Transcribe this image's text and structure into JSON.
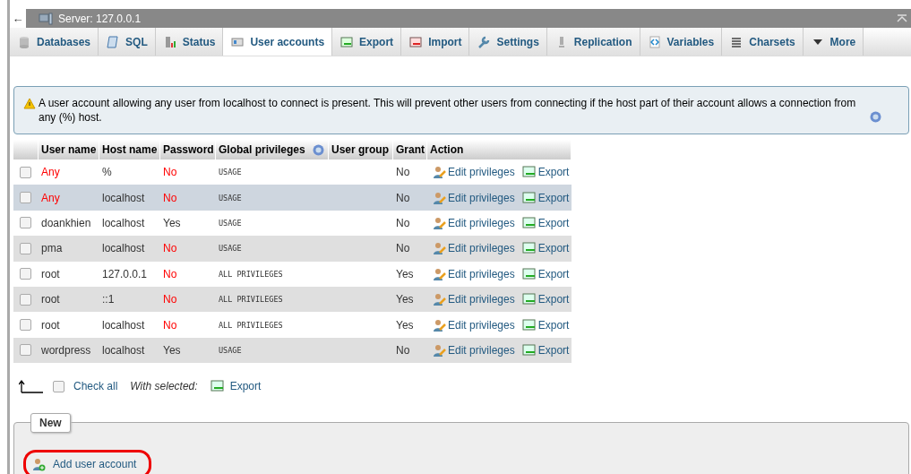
{
  "breadcrumb": {
    "back": "←",
    "server": "Server: 127.0.0.1"
  },
  "tabs": [
    {
      "label": "Databases",
      "kind": "db",
      "selected": false
    },
    {
      "label": "SQL",
      "kind": "sql",
      "selected": false
    },
    {
      "label": "Status",
      "kind": "status",
      "selected": false
    },
    {
      "label": "User accounts",
      "kind": "users",
      "selected": true
    },
    {
      "label": "Export",
      "kind": "export",
      "selected": false
    },
    {
      "label": "Import",
      "kind": "import",
      "selected": false
    },
    {
      "label": "Settings",
      "kind": "settings",
      "selected": false
    },
    {
      "label": "Replication",
      "kind": "replication",
      "selected": false
    },
    {
      "label": "Variables",
      "kind": "variables",
      "selected": false
    },
    {
      "label": "Charsets",
      "kind": "charsets",
      "selected": false
    },
    {
      "label": "More",
      "kind": "more",
      "selected": false
    }
  ],
  "warning": "A user account allowing any user from localhost to connect is present. This will prevent other users from connecting if the host part of their account allows a connection from any (%) host.",
  "table": {
    "columns": [
      "User name",
      "Host name",
      "Password",
      "Global privileges",
      "User group",
      "Grant",
      "Action"
    ],
    "rows": [
      {
        "user": "Any",
        "any_user": true,
        "host": "%",
        "password": "No",
        "password_set": false,
        "privileges": "USAGE",
        "grant": "No",
        "edit": "Edit privileges",
        "export": "Export",
        "checked": false,
        "selected": false
      },
      {
        "user": "Any",
        "any_user": true,
        "host": "localhost",
        "password": "No",
        "password_set": false,
        "privileges": "USAGE",
        "grant": "No",
        "edit": "Edit privileges",
        "export": "Export",
        "checked": false,
        "selected": true
      },
      {
        "user": "doankhien",
        "any_user": false,
        "host": "localhost",
        "password": "Yes",
        "password_set": true,
        "privileges": "USAGE",
        "grant": "No",
        "edit": "Edit privileges",
        "export": "Export",
        "checked": false,
        "selected": false
      },
      {
        "user": "pma",
        "any_user": false,
        "host": "localhost",
        "password": "No",
        "password_set": false,
        "privileges": "USAGE",
        "grant": "No",
        "edit": "Edit privileges",
        "export": "Export",
        "checked": false,
        "selected": false
      },
      {
        "user": "root",
        "any_user": false,
        "host": "127.0.0.1",
        "password": "No",
        "password_set": false,
        "privileges": "ALL PRIVILEGES",
        "grant": "Yes",
        "edit": "Edit privileges",
        "export": "Export",
        "checked": false,
        "selected": false
      },
      {
        "user": "root",
        "any_user": false,
        "host": "::1",
        "password": "No",
        "password_set": false,
        "privileges": "ALL PRIVILEGES",
        "grant": "Yes",
        "edit": "Edit privileges",
        "export": "Export",
        "checked": false,
        "selected": false
      },
      {
        "user": "root",
        "any_user": false,
        "host": "localhost",
        "password": "No",
        "password_set": false,
        "privileges": "ALL PRIVILEGES",
        "grant": "Yes",
        "edit": "Edit privileges",
        "export": "Export",
        "checked": false,
        "selected": false
      },
      {
        "user": "wordpress",
        "any_user": false,
        "host": "localhost",
        "password": "Yes",
        "password_set": true,
        "privileges": "USAGE",
        "grant": "No",
        "edit": "Edit privileges",
        "export": "Export",
        "checked": false,
        "selected": false
      }
    ]
  },
  "bulk": {
    "check_all": "Check all",
    "checked": false,
    "with_selected": "With selected:",
    "export": "Export"
  },
  "new_section": {
    "legend": "New",
    "link": "Add user account",
    "highlighted": true
  }
}
